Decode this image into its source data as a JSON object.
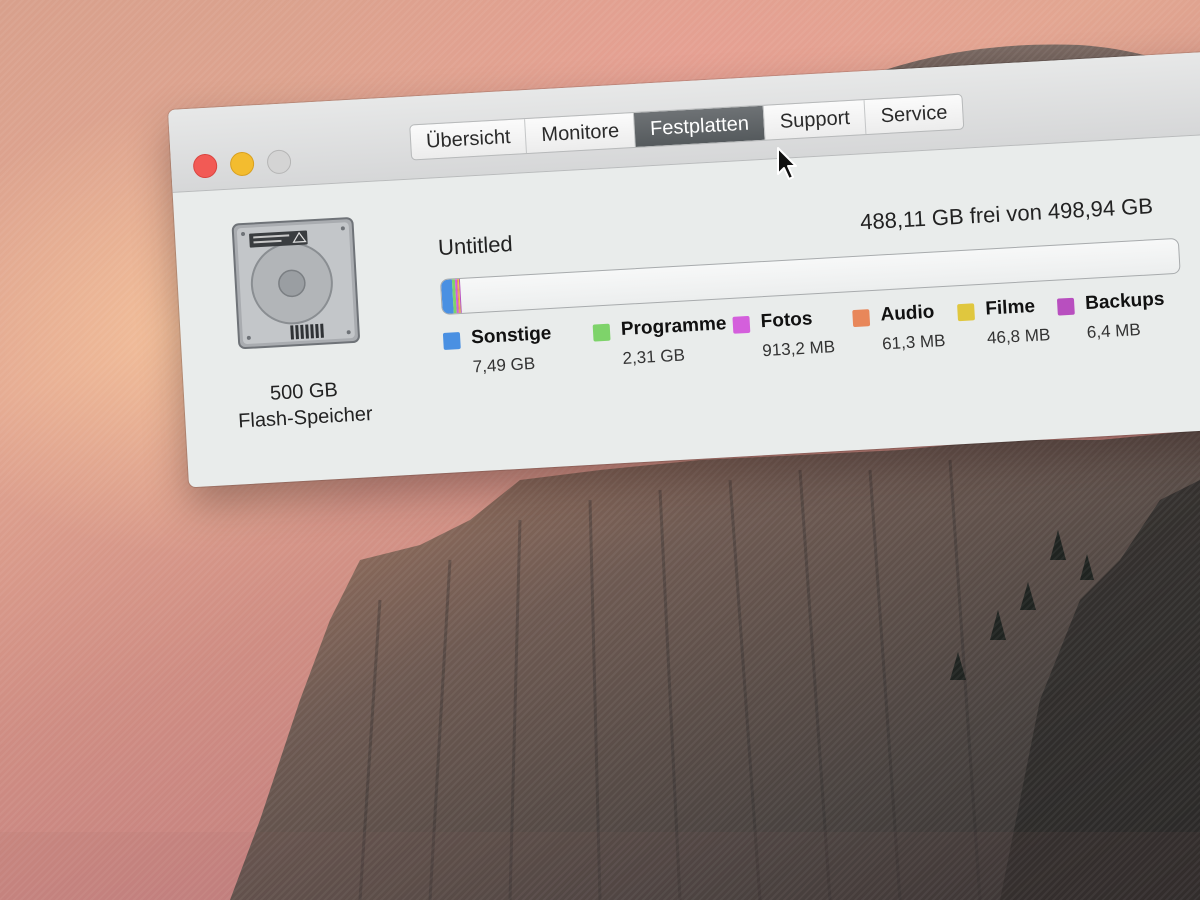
{
  "window": {
    "tabs": [
      {
        "label": "Übersicht",
        "active": false
      },
      {
        "label": "Monitore",
        "active": false
      },
      {
        "label": "Festplatten",
        "active": true
      },
      {
        "label": "Support",
        "active": false
      },
      {
        "label": "Service",
        "active": false
      }
    ]
  },
  "disk": {
    "capacity": "500 GB",
    "type": "Flash-Speicher",
    "volume_name": "Untitled",
    "free_summary": "488,11 GB frei von 498,94 GB",
    "categories": [
      {
        "name": "Sonstige",
        "size": "7,49 GB",
        "color": "#4a90e2",
        "gb": 7.49
      },
      {
        "name": "Programme",
        "size": "2,31 GB",
        "color": "#7ed36a",
        "gb": 2.31
      },
      {
        "name": "Fotos",
        "size": "913,2 MB",
        "color": "#d45fdc",
        "gb": 0.9132
      },
      {
        "name": "Audio",
        "size": "61,3 MB",
        "color": "#e8875a",
        "gb": 0.0613
      },
      {
        "name": "Filme",
        "size": "46,8 MB",
        "color": "#e0c73e",
        "gb": 0.0468
      },
      {
        "name": "Backups",
        "size": "6,4 MB",
        "color": "#b84fbf",
        "gb": 0.0064
      }
    ],
    "total_gb": 498.94
  },
  "icons": {
    "disk": "hard-drive-icon",
    "cursor": "pointer-cursor-icon"
  }
}
